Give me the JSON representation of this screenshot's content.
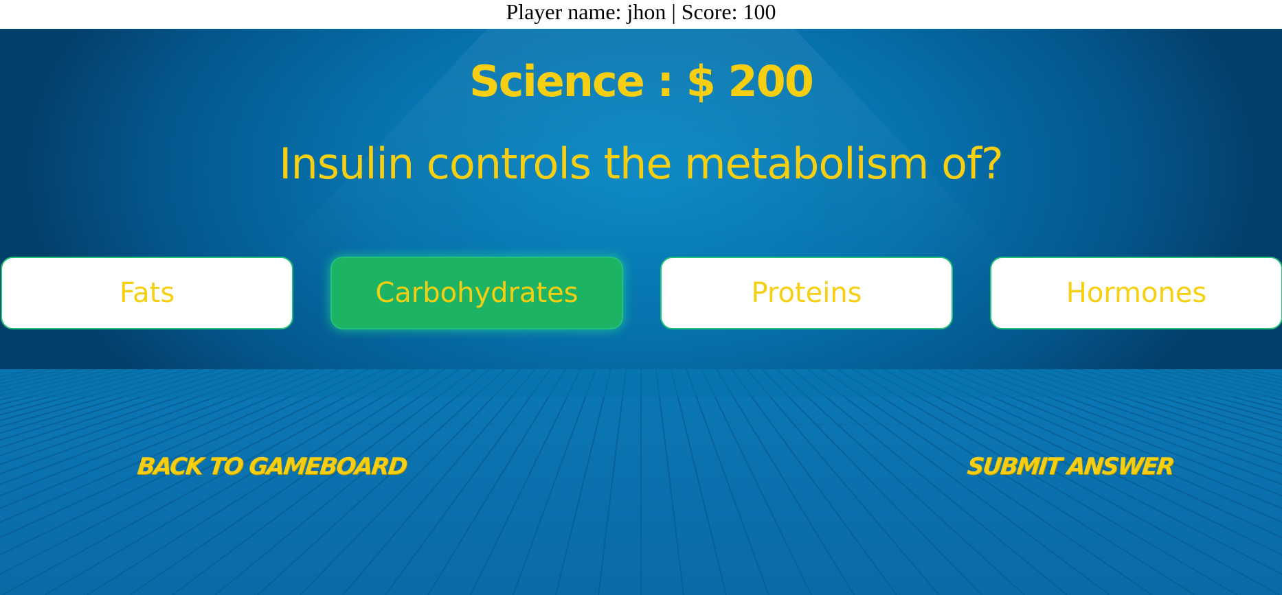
{
  "header": {
    "player_label": "Player name:",
    "player_name": "jhon",
    "separator": "|",
    "score_label": "Score:",
    "score_value": "100"
  },
  "question_card": {
    "category": "Science",
    "separator": ":",
    "value": "$ 200",
    "question": "Insulin controls the metabolism of?"
  },
  "answers": [
    {
      "label": "Fats",
      "selected": false
    },
    {
      "label": "Carbohydrates",
      "selected": true
    },
    {
      "label": "Proteins",
      "selected": false
    },
    {
      "label": "Hormones",
      "selected": false
    }
  ],
  "actions": {
    "back_label": "Back to Gameboard",
    "submit_label": "Submit Answer"
  },
  "colors": {
    "accent_text": "#f6cf12",
    "selected_answer": "#1cb464",
    "answer_border": "#22c27a",
    "stage_blue": "#0672ac"
  }
}
